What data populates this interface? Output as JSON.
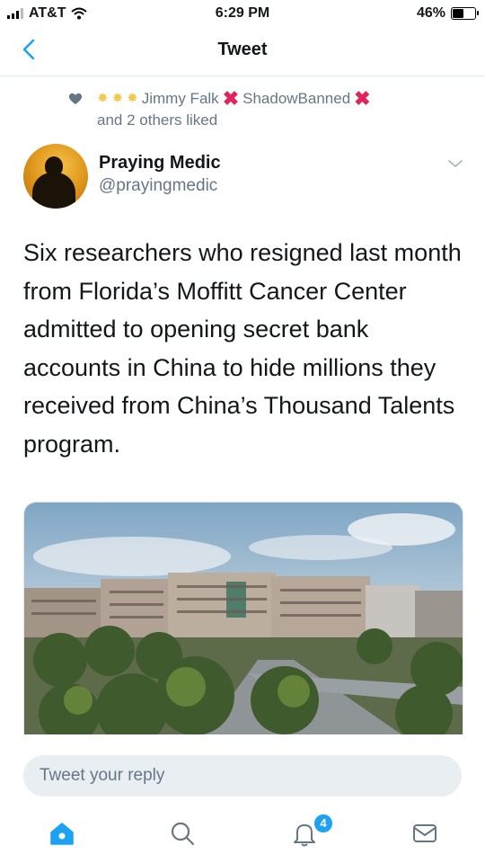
{
  "status_bar": {
    "carrier": "AT&T",
    "time": "6:29 PM",
    "battery": "46%"
  },
  "nav": {
    "title": "Tweet"
  },
  "social_context": {
    "name": "Jimmy Falk",
    "suffix": "ShadowBanned",
    "line2": "and 2 others liked"
  },
  "author": {
    "name": "Praying Medic",
    "handle": "@prayingmedic"
  },
  "tweet": {
    "text": "Six researchers who resigned last month from Florida’s Moffitt Cancer Center admitted to opening secret bank accounts in China to hide millions they received from China’s Thousand Talents program."
  },
  "reply": {
    "placeholder": "Tweet your reply"
  },
  "tabs": {
    "notifications_count": "4"
  },
  "colors": {
    "accent": "#1da1f2",
    "muted": "#657786",
    "star": "#f2c94c",
    "xmark": "#e0245e"
  }
}
